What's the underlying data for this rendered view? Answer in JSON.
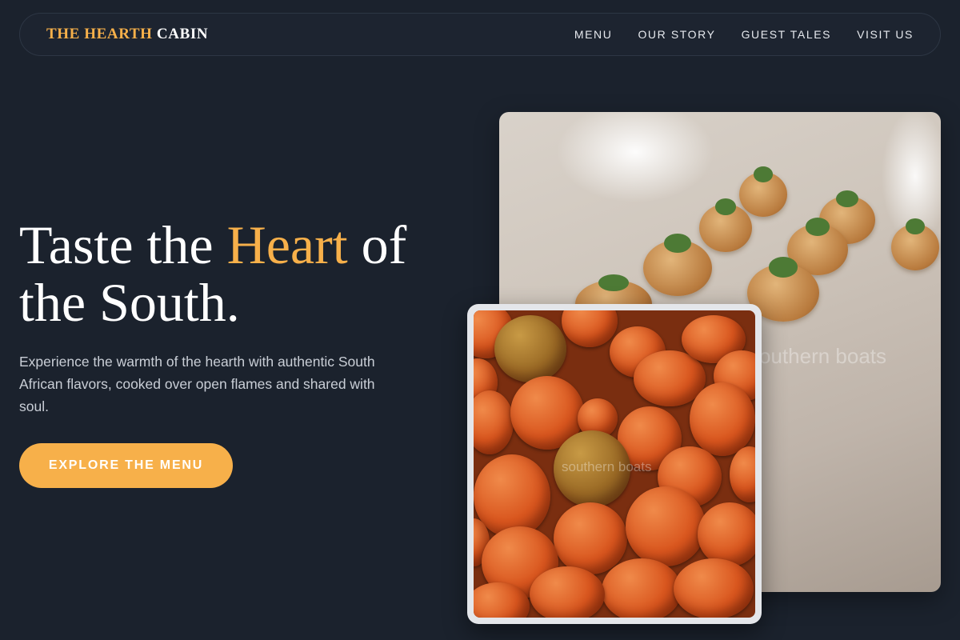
{
  "brand": {
    "accent": "THE HEARTH",
    "rest": "CABIN"
  },
  "nav": {
    "items": [
      {
        "label": "MENU"
      },
      {
        "label": "OUR STORY"
      },
      {
        "label": "GUEST TALES"
      },
      {
        "label": "VISIT US"
      }
    ]
  },
  "hero": {
    "title_before": "Taste the ",
    "title_highlight": "Heart",
    "title_after": " of the South.",
    "subtitle": "Experience the warmth of the hearth with authentic South African flavors, cooked over open flames and shared with soul.",
    "cta_label": "EXPLORE THE MENU"
  },
  "images": {
    "back_alt": "southern boats",
    "front_alt": "southern boats"
  },
  "colors": {
    "background": "#1b222d",
    "accent": "#f7b04a",
    "nav_border": "#2d3644",
    "text": "#ffffff",
    "muted_text": "#c9ced6"
  }
}
